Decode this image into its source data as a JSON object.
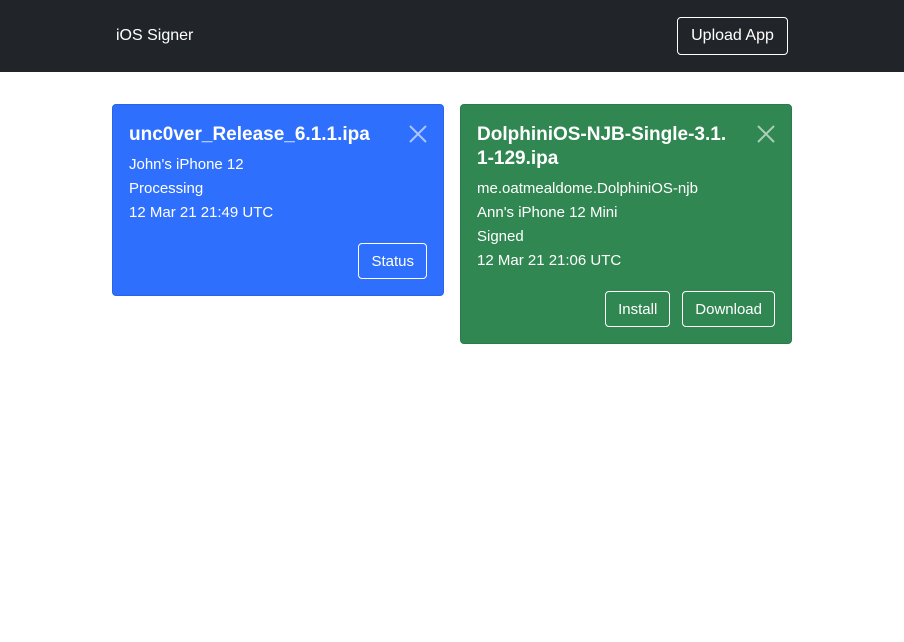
{
  "navbar": {
    "brand": "iOS Signer",
    "upload_label": "Upload App"
  },
  "jobs": [
    {
      "title": "unc0ver_Release_6.1.1.ipa",
      "lines": [
        "John's iPhone 12",
        "Processing",
        "12 Mar 21 21:49 UTC"
      ],
      "status_label": "Status",
      "close_icon": "close-icon",
      "color": "#2f6ffe"
    },
    {
      "title": "DolphiniOS-NJB-Single-3.1.1-129.ipa",
      "lines": [
        "me.oatmealdome.DolphiniOS-njb",
        "Ann's iPhone 12 Mini",
        "Signed",
        "12 Mar 21 21:06 UTC"
      ],
      "install_label": "Install",
      "download_label": "Download",
      "close_icon": "close-icon",
      "color": "#318752"
    }
  ]
}
